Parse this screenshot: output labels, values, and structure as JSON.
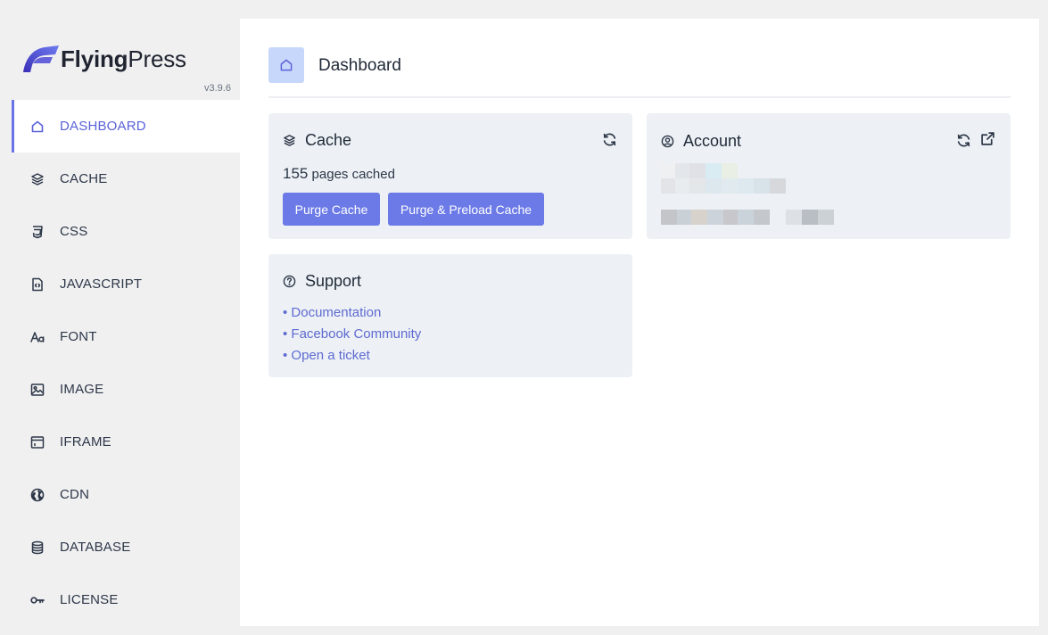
{
  "brand": {
    "name_bold": "Flying",
    "name_thin": "Press",
    "version": "v3.9.6"
  },
  "sidebar": {
    "items": [
      {
        "label": "DASHBOARD",
        "icon": "home-icon",
        "active": true
      },
      {
        "label": "CACHE",
        "icon": "layers-icon"
      },
      {
        "label": "CSS",
        "icon": "css3-icon"
      },
      {
        "label": "JAVASCRIPT",
        "icon": "file-code-icon"
      },
      {
        "label": "FONT",
        "icon": "font-icon"
      },
      {
        "label": "IMAGE",
        "icon": "image-icon"
      },
      {
        "label": "IFRAME",
        "icon": "window-icon"
      },
      {
        "label": "CDN",
        "icon": "globe-icon"
      },
      {
        "label": "DATABASE",
        "icon": "database-icon"
      },
      {
        "label": "LICENSE",
        "icon": "key-icon"
      }
    ]
  },
  "header": {
    "title": "Dashboard"
  },
  "cache": {
    "title": "Cache",
    "count": "155",
    "count_suffix": "pages cached",
    "purge_label": "Purge Cache",
    "purge_preload_label": "Purge & Preload Cache"
  },
  "account": {
    "title": "Account"
  },
  "support": {
    "title": "Support",
    "links": [
      "• Documentation",
      "• Facebook Community",
      "• Open a ticket"
    ]
  },
  "colors": {
    "accent": "#6b7ae6",
    "link": "#5e6ad2",
    "card_bg": "#edf1f5",
    "header_icon_bg": "#c7d7fb"
  }
}
